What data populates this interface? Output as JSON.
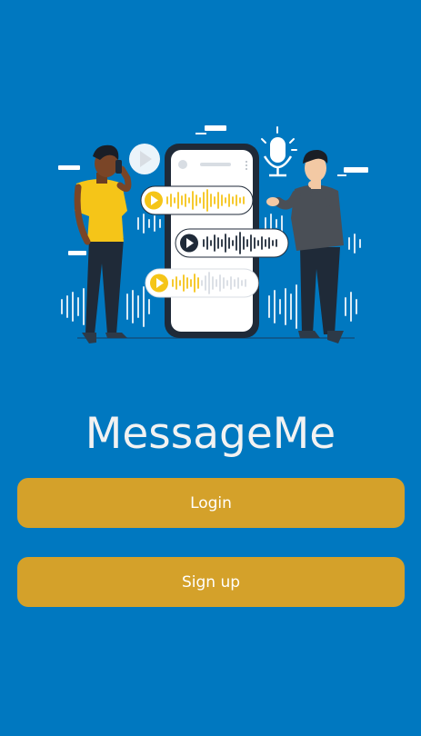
{
  "app": {
    "title": "MessageMe"
  },
  "actions": {
    "login_label": "Login",
    "signup_label": "Sign up"
  },
  "illustration": {
    "icon": "voice-messaging-illustration",
    "colors": {
      "background": "#0078C0",
      "accent": "#F5C518",
      "button": "#D4A12A",
      "phone": "#1f2a38"
    }
  }
}
